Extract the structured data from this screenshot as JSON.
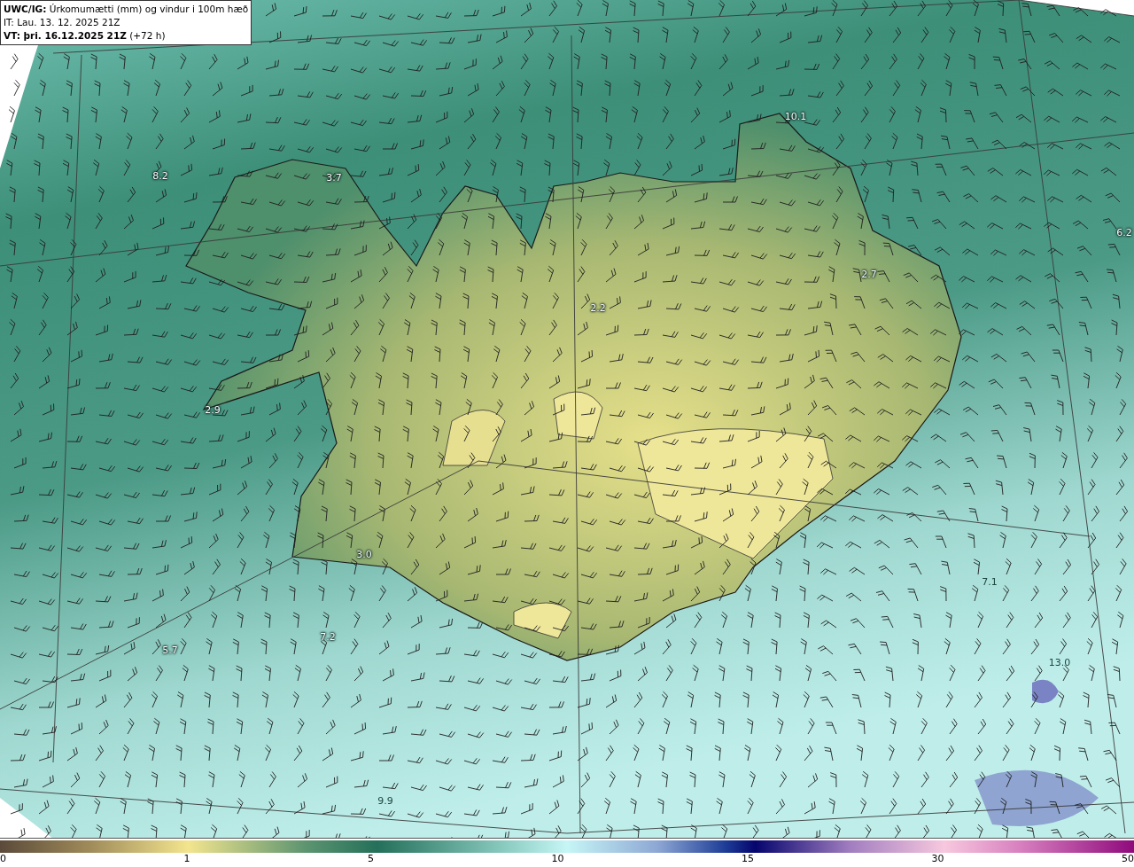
{
  "header": {
    "title": "**UWC/IG:** Úrkomumætti (mm) og vindur i 100m hæð",
    "issued": "IT: Lau. 13. 12. 2025 21Z",
    "valid": "**VT: þri. 16.12.2025 21Z** (+72 h)"
  },
  "map": {
    "value_labels": [
      "10.1",
      "8.2",
      "3.7",
      "6.2",
      "2.7",
      "2.2",
      "2.9",
      "3.0",
      "7.1",
      "5.7",
      "7.2",
      "13.0",
      "9.9"
    ]
  },
  "colorbar": {
    "ticks": [
      "0",
      "1",
      "5",
      "10",
      "15",
      "30",
      "50"
    ]
  }
}
